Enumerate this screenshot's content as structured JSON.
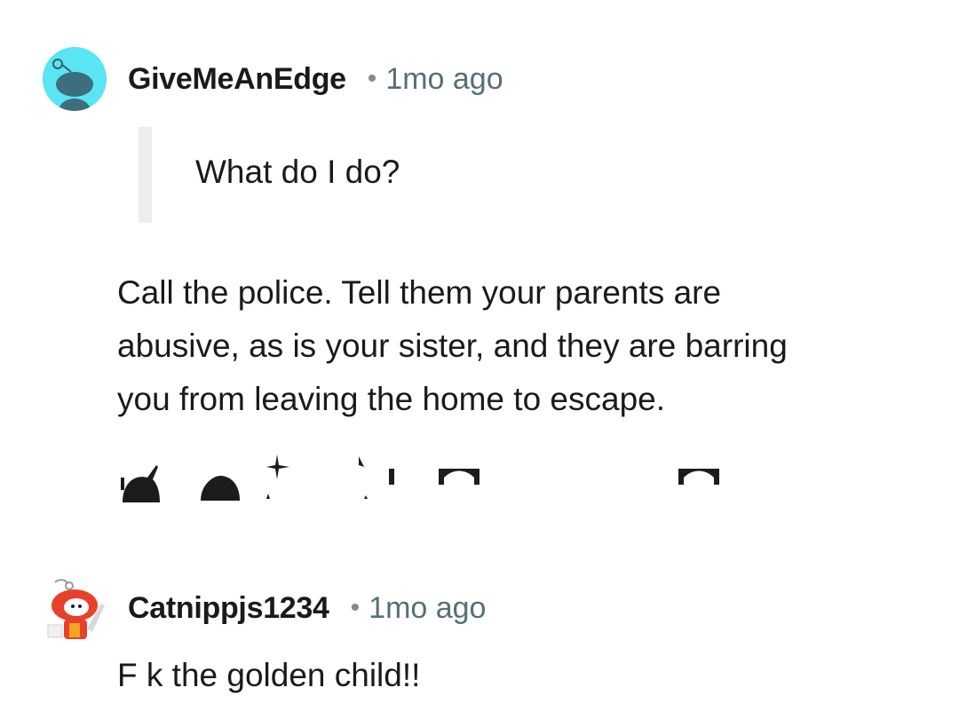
{
  "comments": [
    {
      "username": "GiveMeAnEdge",
      "separator": "•",
      "time": "1mo ago",
      "quote": "What do I do?",
      "body": [
        "Call the police. Tell them your parents are",
        "abusive, as is your sister, and they are barring",
        "you from leaving the home to escape."
      ],
      "actions": [
        "upvote-icon",
        "downvote-icon",
        "award-icon",
        "share-icon",
        "reply-icon",
        "more-icon"
      ]
    },
    {
      "username": "Catnippjs1234",
      "separator": "•",
      "time": "1mo ago",
      "body": "F  k the golden child!!"
    }
  ],
  "colors": {
    "avatar_bg": "#59e5f3",
    "snoo_red": "#e8412b",
    "quote_bar": "#ededed",
    "muted": "#576f76"
  }
}
